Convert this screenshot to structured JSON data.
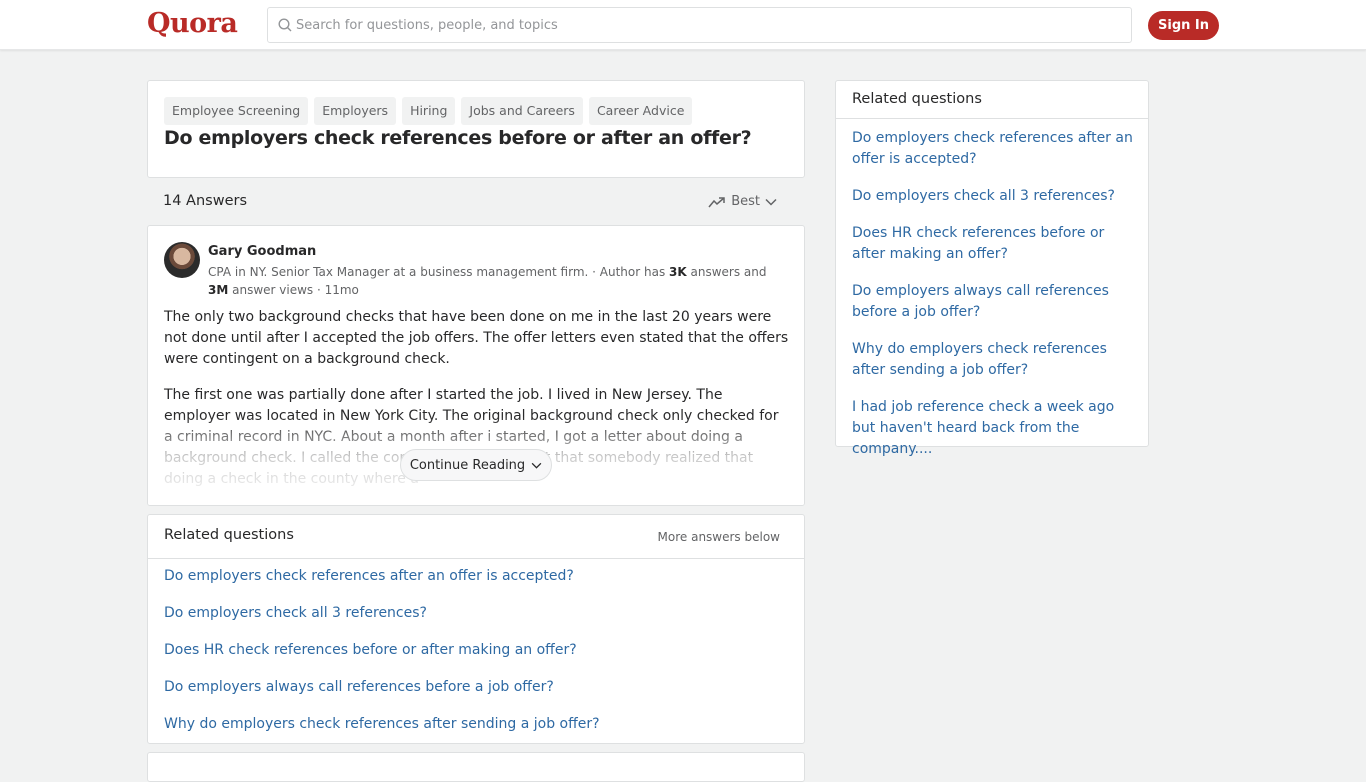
{
  "header": {
    "logo": "Quora",
    "search_placeholder": "Search for questions, people, and topics",
    "sign_in": "Sign In",
    "brand_color": "#b92b27"
  },
  "question": {
    "topics": [
      "Employee Screening",
      "Employers",
      "Hiring",
      "Jobs and Careers",
      "Career Advice"
    ],
    "title": "Do employers check references before or after an offer?"
  },
  "answers_bar": {
    "count_label": "14 Answers",
    "sort_label": "Best",
    "sort_icon": "trending-up-icon"
  },
  "answer": {
    "author_name": "Gary Goodman",
    "credential": "CPA in NY. Senior Tax Manager at a business management firm. · Author has ",
    "answers_count": "3K",
    "answers_mid": " answers and ",
    "views_count": "3M",
    "views_suffix": " answer views · 11mo",
    "paragraphs": [
      "The only two background checks that have been done on me in the last 20 years were not done until after I accepted the job offers. The offer letters even stated that the offers were contingent on a background check.",
      "The first one was partially done after I started the job. I lived in New Jersey. The employer was located in New York City. The original background check only checked for a criminal record in NYC. About a month after i started, I got a letter about doing a background check. I called the company and found out that somebody realized that doing a check in the county where a"
    ],
    "continue_label": "Continue Reading"
  },
  "related_inline": {
    "title": "Related questions",
    "more_label": "More answers below",
    "items": [
      "Do employers check references after an offer is accepted?",
      "Do employers check all 3 references?",
      "Does HR check references before or after making an offer?",
      "Do employers always call references before a job offer?",
      "Why do employers check references after sending a job offer?"
    ]
  },
  "related_sidebar": {
    "title": "Related questions",
    "items": [
      "Do employers check references after an offer is accepted?",
      "Do employers check all 3 references?",
      "Does HR check references before or after making an offer?",
      "Do employers always call references before a job offer?",
      "Why do employers check references after sending a job offer?",
      "I had job reference check a week ago but haven't heard back from the company...."
    ],
    "link_color": "#2e69a3"
  }
}
